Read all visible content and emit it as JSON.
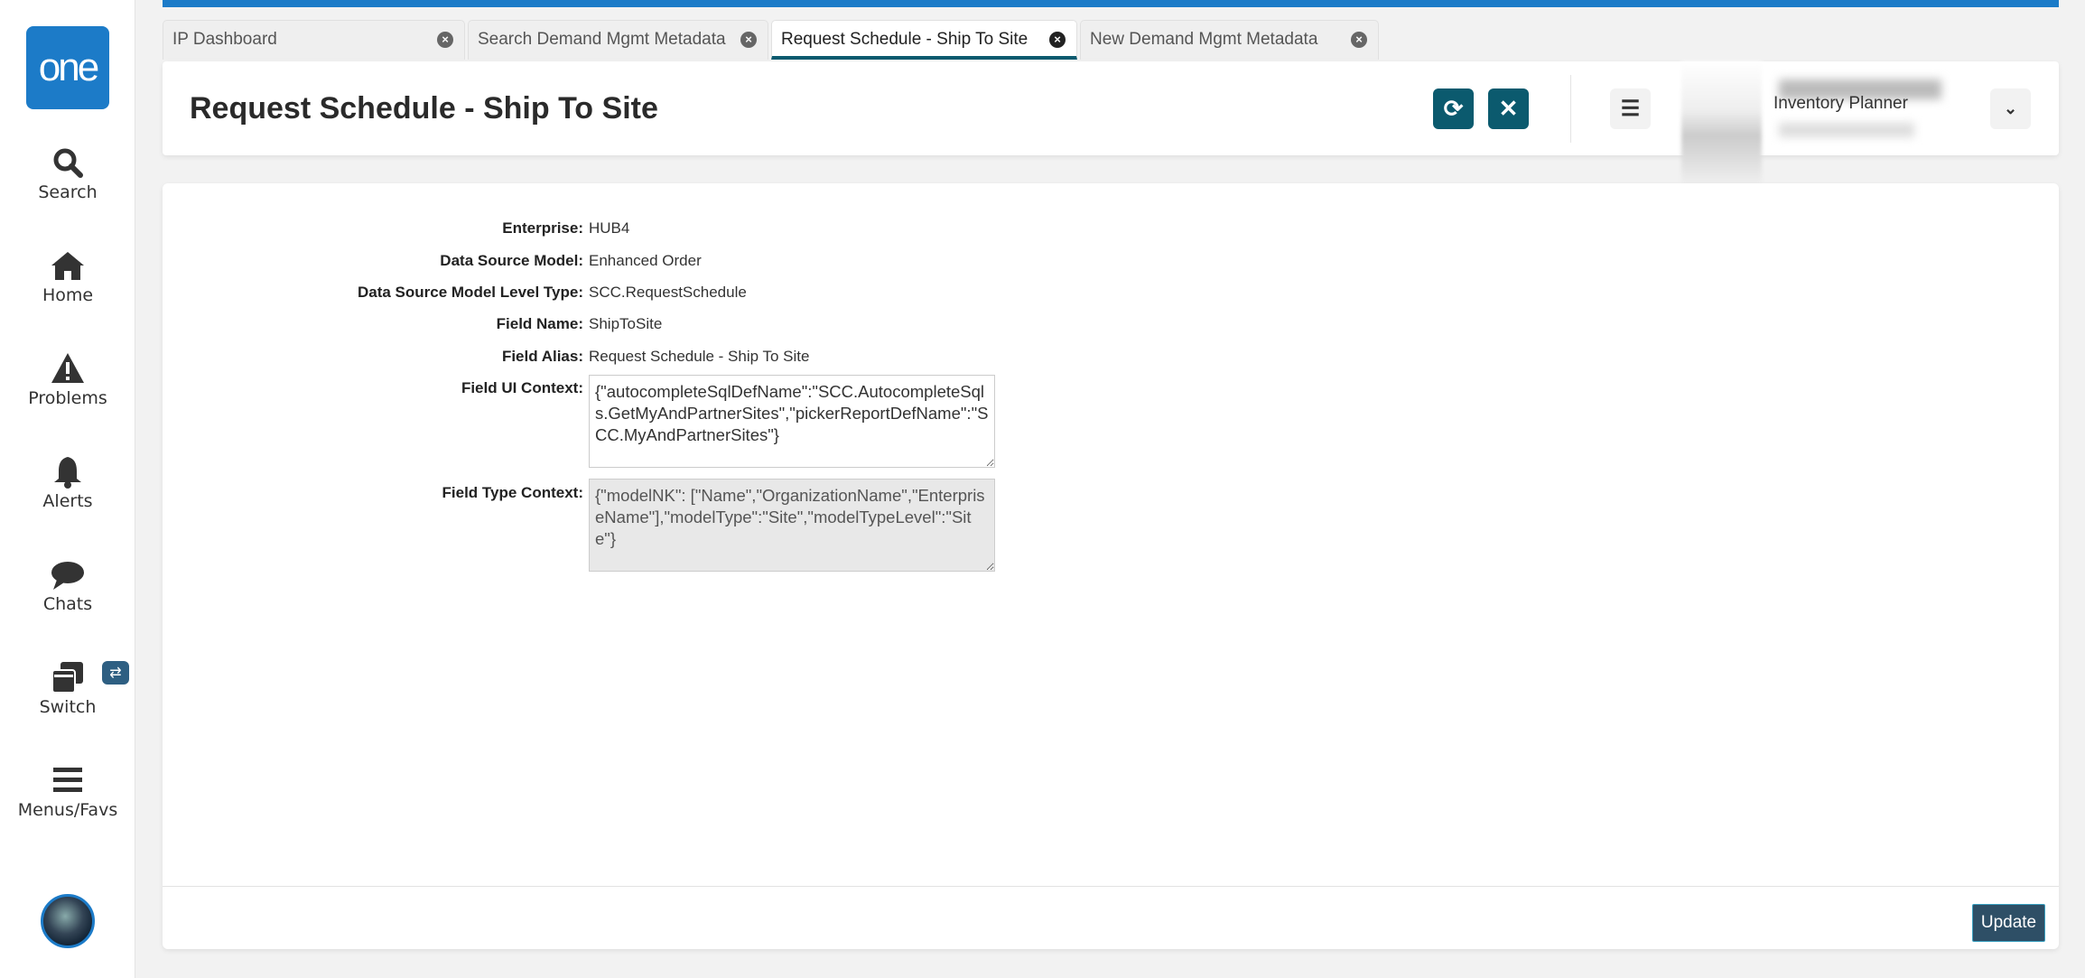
{
  "sidebar": {
    "logo": "one",
    "items": [
      {
        "label": "Search",
        "icon": "search-icon"
      },
      {
        "label": "Home",
        "icon": "home-icon"
      },
      {
        "label": "Problems",
        "icon": "warning-icon"
      },
      {
        "label": "Alerts",
        "icon": "bell-icon"
      },
      {
        "label": "Chats",
        "icon": "chat-icon"
      },
      {
        "label": "Switch",
        "icon": "windows-icon"
      },
      {
        "label": "Menus/Favs",
        "icon": "menu-icon"
      }
    ]
  },
  "tabs": [
    {
      "label": "IP Dashboard",
      "active": false
    },
    {
      "label": "Search Demand Mgmt Metadata",
      "active": false
    },
    {
      "label": "Request Schedule - Ship To Site",
      "active": true
    },
    {
      "label": "New Demand Mgmt Metadata",
      "active": false
    }
  ],
  "header": {
    "title": "Request Schedule - Ship To Site",
    "role": "Inventory Planner"
  },
  "form": {
    "enterprise": {
      "label": "Enterprise:",
      "value": "HUB4"
    },
    "data_source_model": {
      "label": "Data Source Model:",
      "value": "Enhanced Order"
    },
    "level_type": {
      "label": "Data Source Model Level Type:",
      "value": "SCC.RequestSchedule"
    },
    "field_name": {
      "label": "Field Name:",
      "value": "ShipToSite"
    },
    "field_alias": {
      "label": "Field Alias:",
      "value": "Request Schedule - Ship To Site"
    },
    "ui_context": {
      "label": "Field UI Context:",
      "value": "{\"autocompleteSqlDefName\":\"SCC.AutocompleteSqls.GetMyAndPartnerSites\",\"pickerReportDefName\":\"SCC.MyAndPartnerSites\"}"
    },
    "type_context": {
      "label": "Field Type Context:",
      "value": "{\"modelNK\": [\"Name\",\"OrganizationName\",\"EnterpriseName\"],\"modelType\":\"Site\",\"modelTypeLevel\":\"Site\"}"
    }
  },
  "footer": {
    "update_label": "Update"
  },
  "colors": {
    "brand": "#1c7bc8",
    "accent": "#0b5a6e",
    "update": "#2e4f66"
  }
}
